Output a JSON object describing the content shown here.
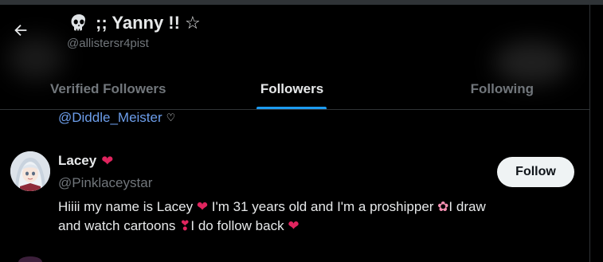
{
  "header": {
    "display_name": ";; Yanny !! ☆",
    "handle": "@allistersr4pist",
    "skull_icon": "skull-icon",
    "back_icon": "arrow-left-icon"
  },
  "tabs": [
    {
      "label": "Verified Followers",
      "active": false
    },
    {
      "label": "Followers",
      "active": true
    },
    {
      "label": "Following",
      "active": false
    }
  ],
  "previous_bio": {
    "mention": "@Diddle_Meister",
    "suffix": "♡"
  },
  "user": {
    "name": "Lacey",
    "name_emoji": "❤",
    "handle": "@Pinklaceystar",
    "follow_label": "Follow",
    "bio_line1_a": "Hiiii my name is Lacey ",
    "bio_line1_b": " I'm 31 years old and I'm a proshipper ",
    "bio_line1_c": "I draw",
    "bio_line2_a": "and watch cartoons ",
    "bio_line2_b": "I do follow back ",
    "heart": "❤",
    "exclaim_heart": "❣",
    "lotus": "✿"
  },
  "colors": {
    "accent": "#1d9bf0",
    "mention": "#6d9eeb",
    "heart": "#e0245e",
    "muted": "#71767b"
  }
}
